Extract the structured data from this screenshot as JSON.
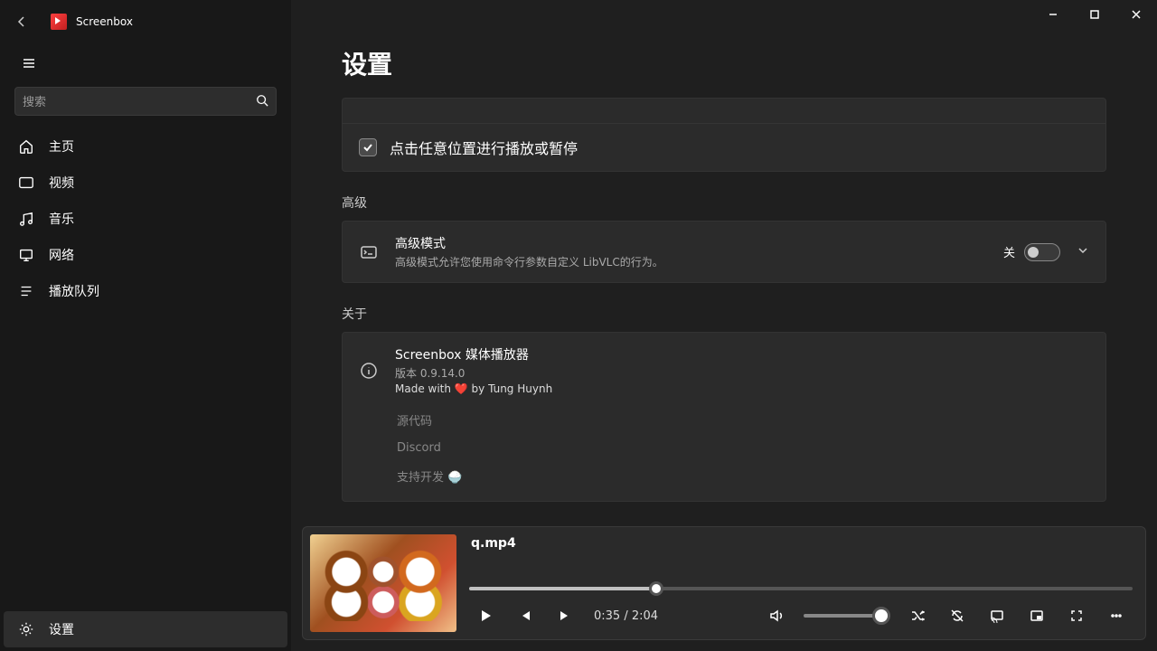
{
  "app": {
    "name": "Screenbox"
  },
  "search": {
    "placeholder": "搜索"
  },
  "nav": {
    "home": "主页",
    "video": "视频",
    "music": "音乐",
    "network": "网络",
    "queue": "播放队列",
    "settings": "设置"
  },
  "page": {
    "title": "设置"
  },
  "settings": {
    "click_anywhere_label": "点击任意位置进行播放或暂停",
    "advanced_section": "高级",
    "advanced_mode_title": "高级模式",
    "advanced_mode_desc": "高级模式允许您使用命令行参数自定义 LibVLC的行为。",
    "toggle_off": "关",
    "about_section": "关于",
    "about_title": "Screenbox 媒体播放器",
    "about_version": "版本 0.9.14.0",
    "about_made": "Made with ❤️ by Tung Huynh",
    "link_source": "源代码",
    "link_discord": "Discord",
    "link_support": "支持开发 🍚"
  },
  "player": {
    "media_title": "q.mp4",
    "current_time": "0:35",
    "total_time": "2:04",
    "progress_percent": 28.2,
    "volume_percent": 100
  }
}
